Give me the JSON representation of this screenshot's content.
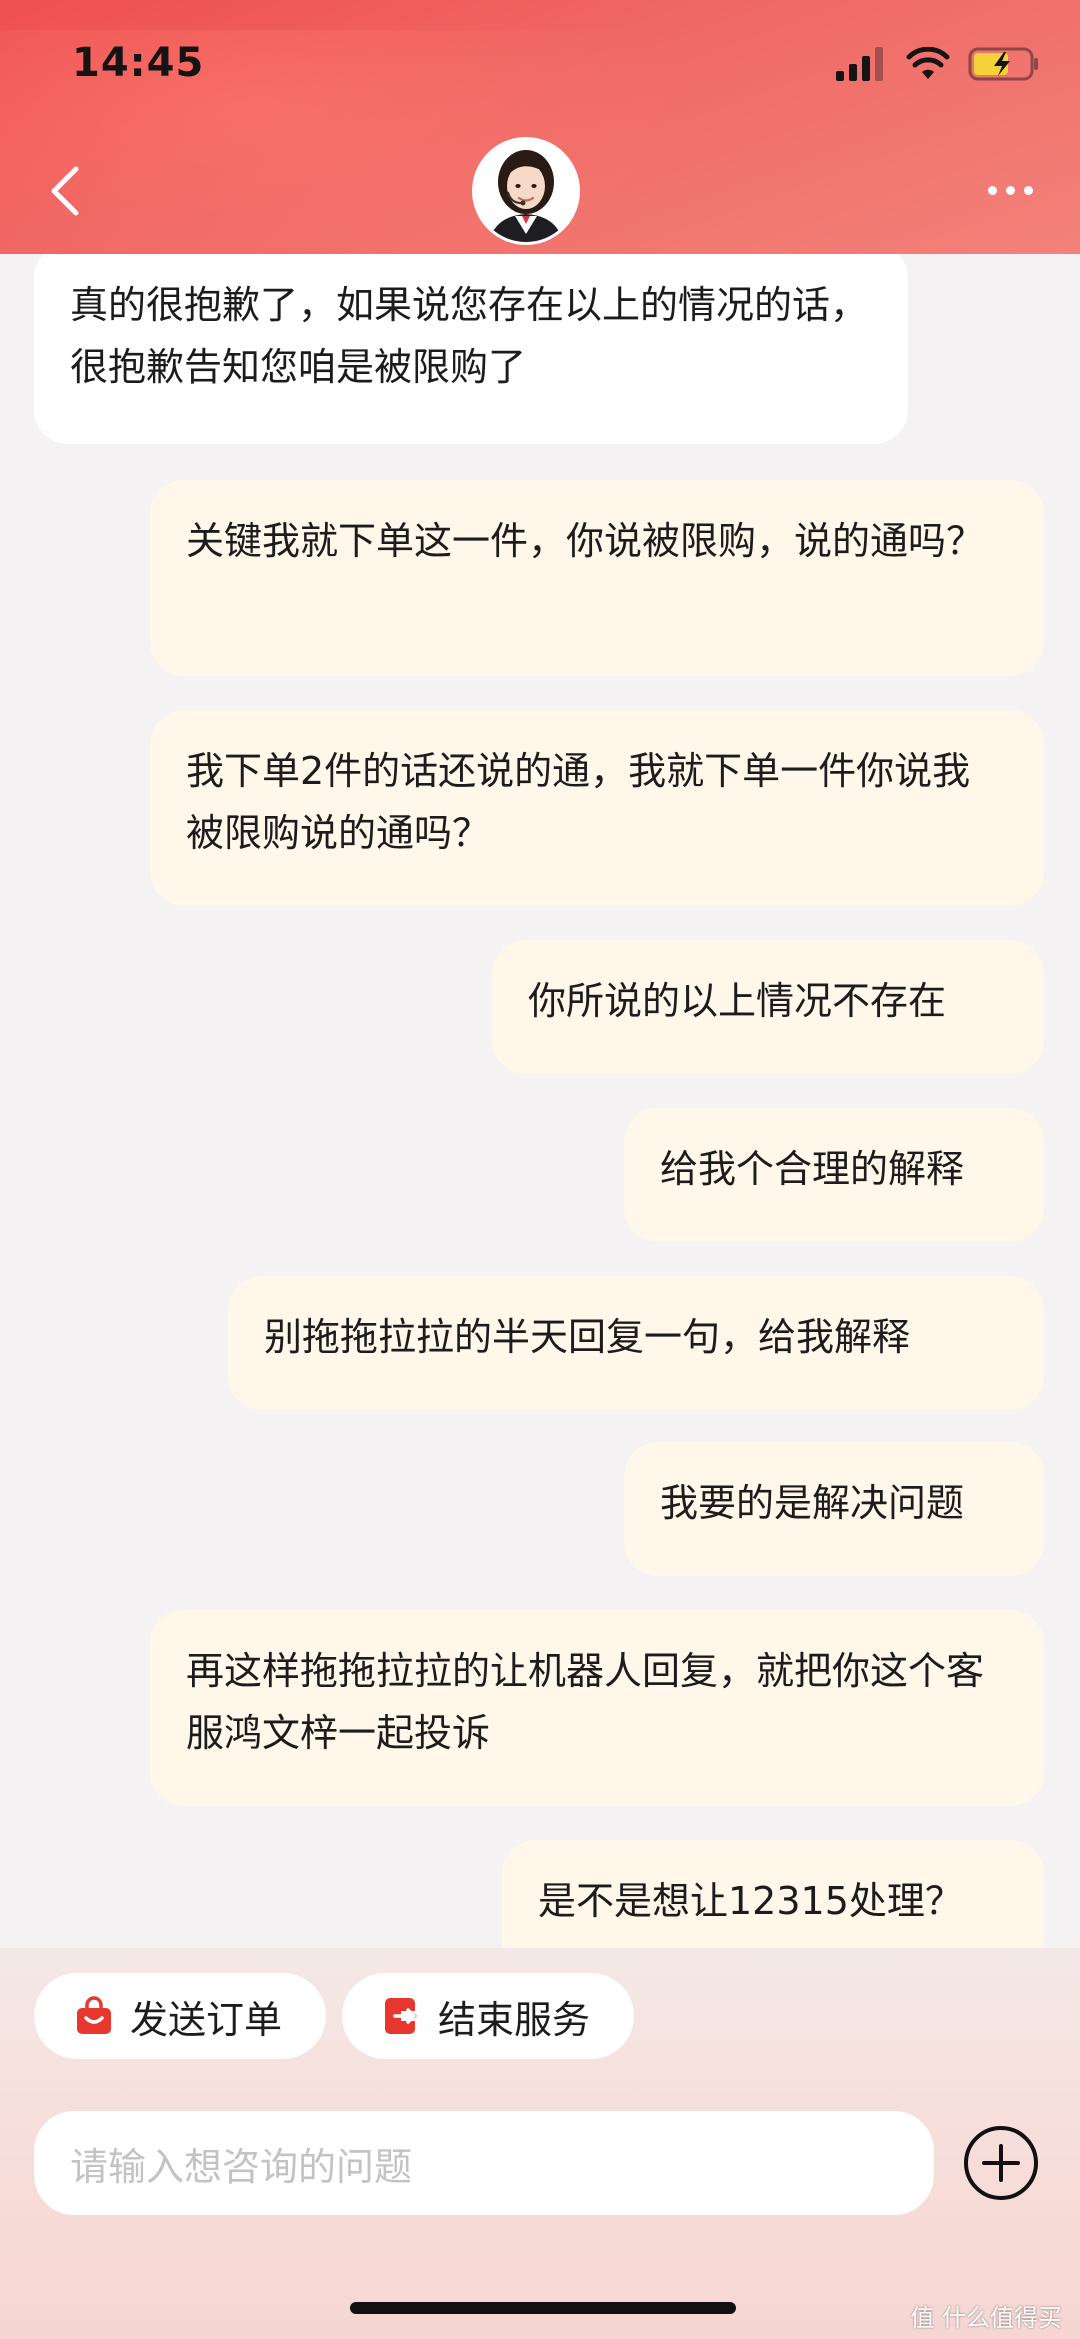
{
  "status_bar": {
    "time": "14:45"
  },
  "header": {
    "avatar_alt": "客服头像"
  },
  "messages": [
    {
      "sender": "agent",
      "text": "真的很抱歉了，如果说您存在以上的情况的话，很抱歉告知您咱是被限购了"
    },
    {
      "sender": "user",
      "text": "关键我就下单这一件，你说被限购，说的通吗？"
    },
    {
      "sender": "user",
      "text": "我下单2件的话还说的通，我就下单一件你说我被限购说的通吗？"
    },
    {
      "sender": "user",
      "text": "你所说的以上情况不存在"
    },
    {
      "sender": "user",
      "text": "给我个合理的解释"
    },
    {
      "sender": "user",
      "text": "别拖拖拉拉的半天回复一句，给我解释"
    },
    {
      "sender": "user",
      "text": "我要的是解决问题"
    },
    {
      "sender": "user",
      "text": "再这样拖拖拉拉的让机器人回复，就把你这个客服鸿文梓一起投诉"
    },
    {
      "sender": "user",
      "text": "是不是想让12315处理？"
    }
  ],
  "quick_actions": [
    {
      "label": "发送订单",
      "icon": "shopping-bag-icon",
      "color": "#e8372f"
    },
    {
      "label": "结束服务",
      "icon": "exit-icon",
      "color": "#e8372f"
    }
  ],
  "input": {
    "placeholder": "请输入想咨询的问题"
  },
  "watermark": {
    "text": "值 什么值得买"
  },
  "colors": {
    "header_red": "#ef4f4f",
    "agent_bubble": "#ffffff",
    "user_bubble": "#fff7ea",
    "accent": "#e8372f"
  }
}
